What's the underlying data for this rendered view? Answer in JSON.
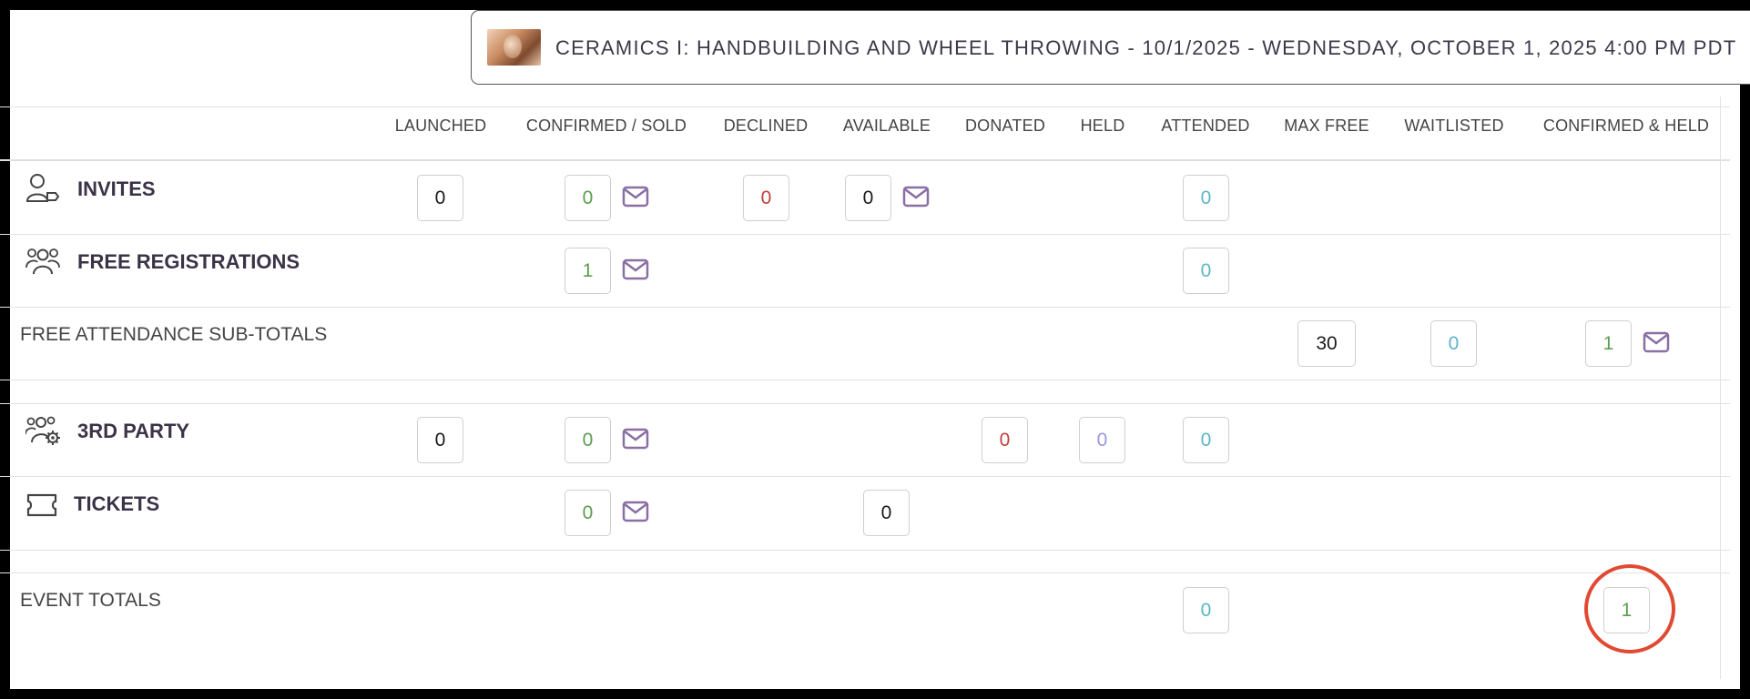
{
  "event": {
    "title": "CERAMICS I: HANDBUILDING AND WHEEL THROWING - 10/1/2025 - WEDNESDAY, OCTOBER 1, 2025 4:00 PM PDT"
  },
  "columns": [
    "LAUNCHED",
    "CONFIRMED / SOLD",
    "DECLINED",
    "AVAILABLE",
    "DONATED",
    "HELD",
    "ATTENDED",
    "MAX FREE",
    "WAITLISTED",
    "CONFIRMED & HELD"
  ],
  "rows": {
    "invites": {
      "label": "INVITES",
      "launched": "0",
      "confirmed": "0",
      "declined": "0",
      "available": "0",
      "attended": "0"
    },
    "free_registrations": {
      "label": "FREE REGISTRATIONS",
      "confirmed": "1",
      "attended": "0"
    },
    "free_subtotals": {
      "label": "FREE ATTENDANCE SUB-TOTALS",
      "max_free": "30",
      "waitlisted": "0",
      "confirmed_held": "1"
    },
    "third_party": {
      "label": "3RD PARTY",
      "launched": "0",
      "confirmed": "0",
      "donated": "0",
      "held": "0",
      "attended": "0"
    },
    "tickets": {
      "label": "TICKETS",
      "confirmed": "0",
      "available": "0"
    },
    "event_totals": {
      "label": "EVENT TOTALS",
      "attended": "0",
      "confirmed_held": "1"
    }
  },
  "colors": {
    "green": "#5a9e4d",
    "red": "#c23f3b",
    "teal": "#5bb6c5",
    "lavender": "#9a95e6",
    "mail_icon": "#8a6fa5",
    "highlight": "#e14a32"
  },
  "icons": {
    "invites": "user-tag-icon",
    "free_registrations": "users-group-icon",
    "third_party": "users-gear-icon",
    "tickets": "ticket-icon",
    "mail": "envelope-icon"
  }
}
